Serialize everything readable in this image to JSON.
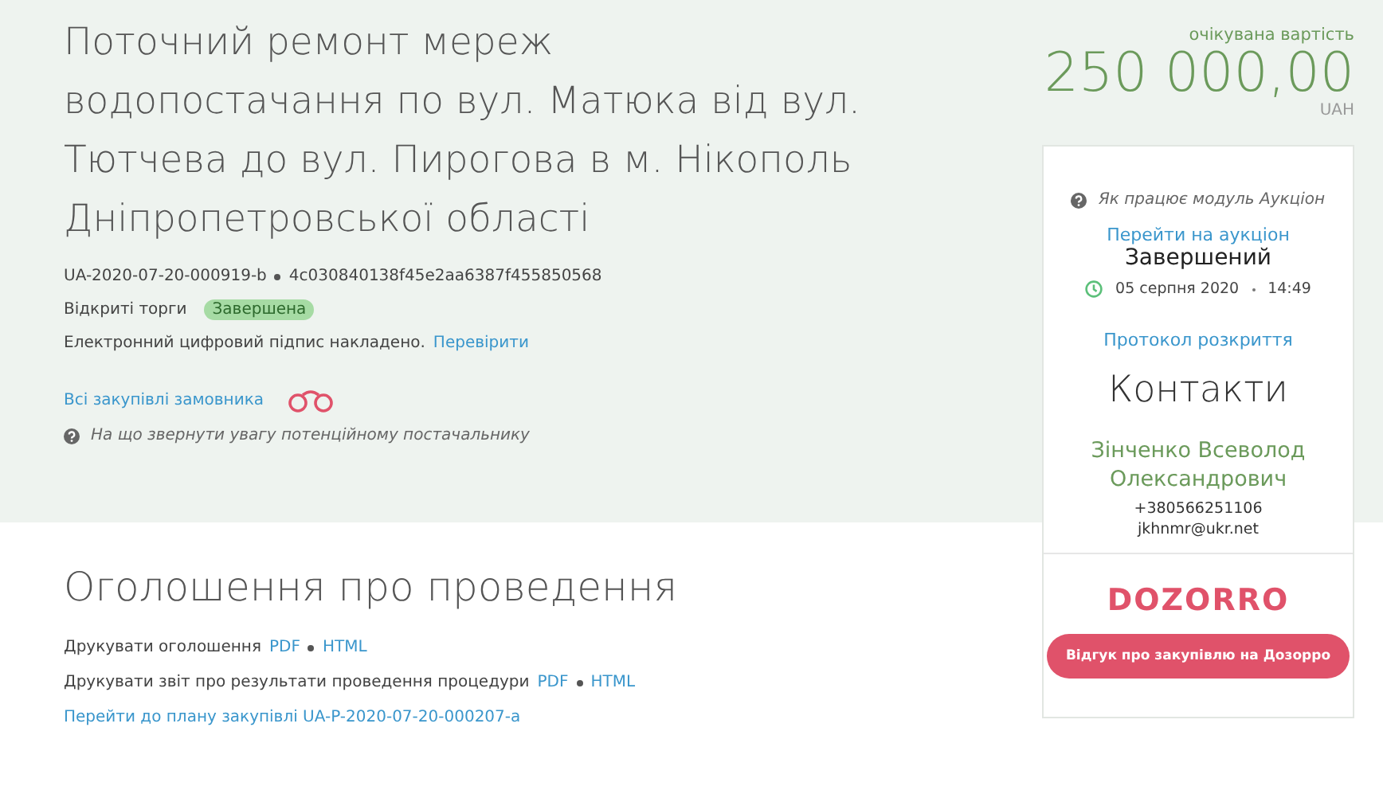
{
  "tender": {
    "title": "Поточний ремонт мереж водопостачання по вул. Матюка від вул. Тютчева до вул. Пирогова в м. Нікополь Дніпропетровської області",
    "tender_id": "UA-2020-07-20-000919-b",
    "hash": "4c030840138f45e2aa6387f455850568",
    "procedure_type": "Відкриті торги",
    "status_badge": "Завершена",
    "signature_text": "Електронний цифровий підпис накладено.",
    "signature_link": "Перевірити",
    "customer_link": "Всі закупівлі замовника",
    "hint": "На що звернути увагу потенційному постачальнику"
  },
  "price": {
    "label": "очікувана вартість",
    "amount": "250 000,00",
    "currency": "UAH"
  },
  "auction": {
    "hint": "Як працює модуль Аукціон",
    "link": "Перейти на аукціон",
    "status": "Завершений",
    "date": "05 серпня 2020",
    "time": "14:49",
    "protocol_link": "Протокол розкриття"
  },
  "contacts": {
    "title": "Контакти",
    "name": "Зінченко Всеволод Олександрович",
    "phone": "+380566251106",
    "email": "jkhnmr@ukr.net"
  },
  "dozorro": {
    "logo": "DOZORRO",
    "button": "Відгук про закупівлю на Дозорро"
  },
  "announcement": {
    "title": "Оголошення про проведення",
    "rows": [
      {
        "kind": "print",
        "text": "Друкувати оголошення",
        "links": [
          "PDF",
          "HTML"
        ]
      },
      {
        "kind": "print",
        "text": "Друкувати звіт про результати проведення процедури",
        "links": [
          "PDF",
          "HTML"
        ]
      },
      {
        "kind": "link",
        "text": "Перейти до плану закупівлі UA-P-2020-07-20-000207-a"
      }
    ]
  }
}
